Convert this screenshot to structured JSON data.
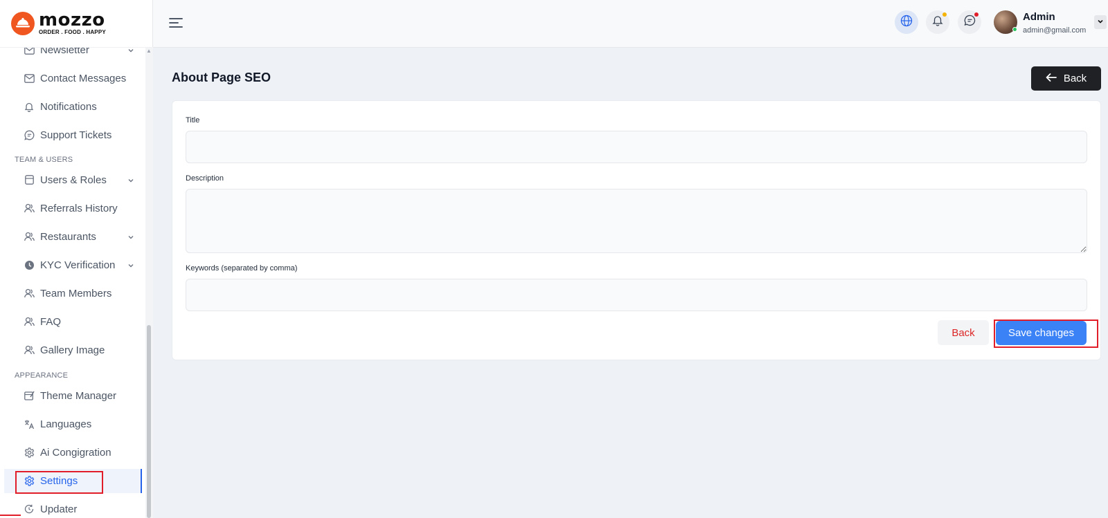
{
  "brand": {
    "name": "mozzo",
    "tagline": "ORDER . FOOD . HAPPY"
  },
  "sidebar": {
    "items_top": [
      {
        "label": "Newsletter",
        "icon": "envelope-icon"
      },
      {
        "label": "Contact Messages",
        "icon": "envelope-icon"
      },
      {
        "label": "Notifications",
        "icon": "bell-icon"
      },
      {
        "label": "Support Tickets",
        "icon": "chat-icon"
      }
    ],
    "section_team": "TEAM & USERS",
    "items_team": [
      {
        "label": "Users & Roles",
        "icon": "user-box-icon"
      },
      {
        "label": "Referrals History",
        "icon": "users-icon"
      },
      {
        "label": "Restaurants",
        "icon": "users-icon"
      },
      {
        "label": "KYC Verification",
        "icon": "clock-icon"
      },
      {
        "label": "Team Members",
        "icon": "users-icon"
      },
      {
        "label": "FAQ",
        "icon": "users-icon"
      },
      {
        "label": "Gallery Image",
        "icon": "users-icon"
      }
    ],
    "section_appearance": "APPEARANCE",
    "items_appearance": [
      {
        "label": "Theme Manager",
        "icon": "theme-icon"
      },
      {
        "label": "Languages",
        "icon": "translate-icon"
      },
      {
        "label": "Ai Congigration",
        "icon": "gear-icon"
      },
      {
        "label": "Settings",
        "icon": "gear-icon",
        "active": true
      },
      {
        "label": "Updater",
        "icon": "refresh-icon"
      }
    ]
  },
  "header": {
    "user": {
      "name": "Admin",
      "email": "admin@gmail.com"
    },
    "notification_dot_color": "#f5b300",
    "message_dot_color": "#e11d2a"
  },
  "main": {
    "title": "About Page SEO",
    "back_label": "Back",
    "form": {
      "title_label": "Title",
      "title_value": "",
      "description_label": "Description",
      "description_value": "",
      "keywords_label": "Keywords (separated by comma)",
      "keywords_value": ""
    },
    "cancel_label": "Back",
    "save_label": "Save changes"
  },
  "colors": {
    "accent": "#3b82f6",
    "brand": "#f0561f",
    "highlight": "#e11d2a"
  }
}
